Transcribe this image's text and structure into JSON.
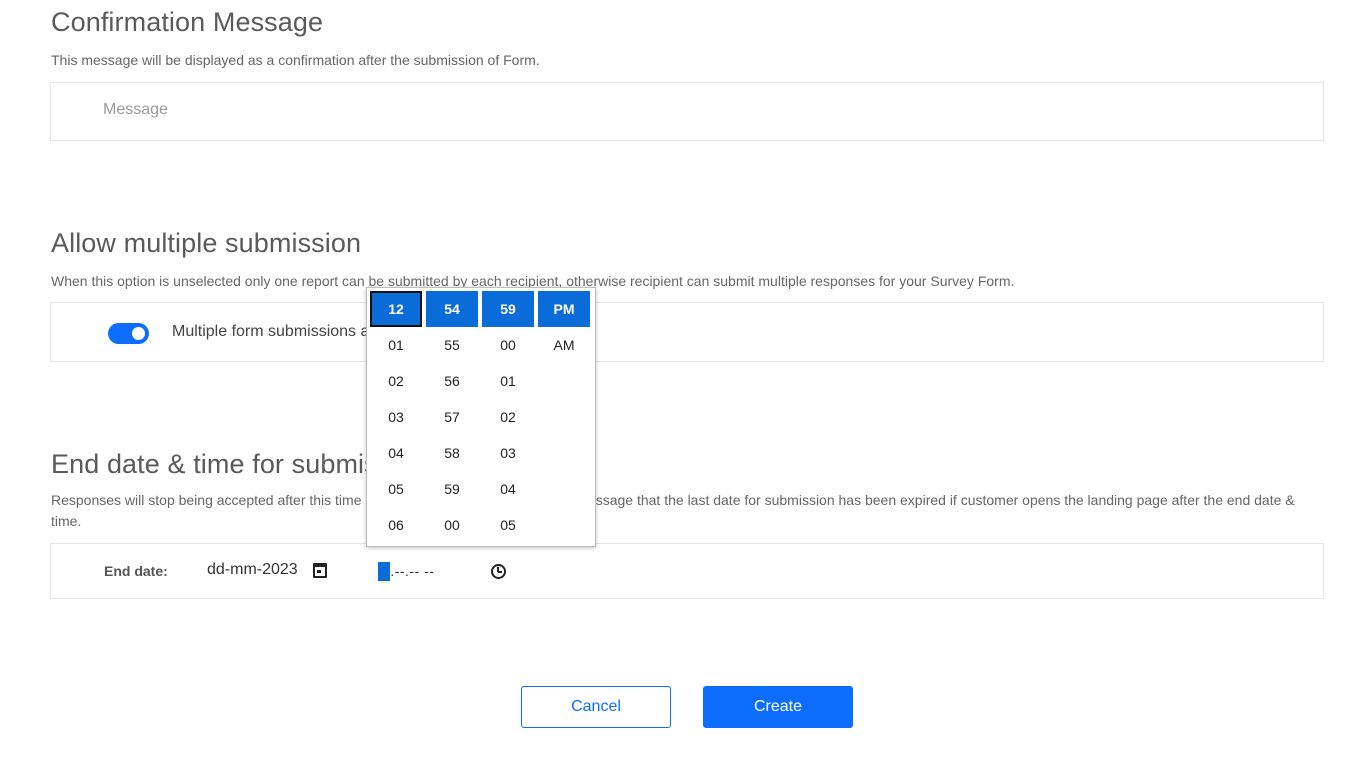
{
  "confirmation": {
    "title": "Confirmation Message",
    "description": "This message will be displayed as a confirmation after the submission of Form.",
    "message_placeholder": "Message"
  },
  "multiple": {
    "title": "Allow multiple submission",
    "description": "When this option is unselected only one report can be submitted by each recipient, otherwise recipient can submit multiple responses for your Survey Form.",
    "toggle_on": true,
    "label": "Multiple form submissions allowed per contact"
  },
  "end": {
    "title": "End date & time for submission",
    "description": "Responses will stop being accepted after this time and the customer will be shown a message that the last date for submission has been expired if customer opens the landing page after the end date & time.",
    "label": "End date:",
    "date_prefix": "dd-mm-",
    "date_year": "2023",
    "time_hour": "--",
    "time_rest": ".--.-- --"
  },
  "time_picker": {
    "hours": [
      "12",
      "01",
      "02",
      "03",
      "04",
      "05",
      "06"
    ],
    "minutes": [
      "54",
      "55",
      "56",
      "57",
      "58",
      "59",
      "00"
    ],
    "seconds": [
      "59",
      "00",
      "01",
      "02",
      "03",
      "04",
      "05"
    ],
    "periods": [
      "PM",
      "AM"
    ]
  },
  "buttons": {
    "cancel": "Cancel",
    "create": "Create"
  },
  "colors": {
    "accent": "#0d6efd",
    "picker_selected": "#0a6cd9"
  }
}
